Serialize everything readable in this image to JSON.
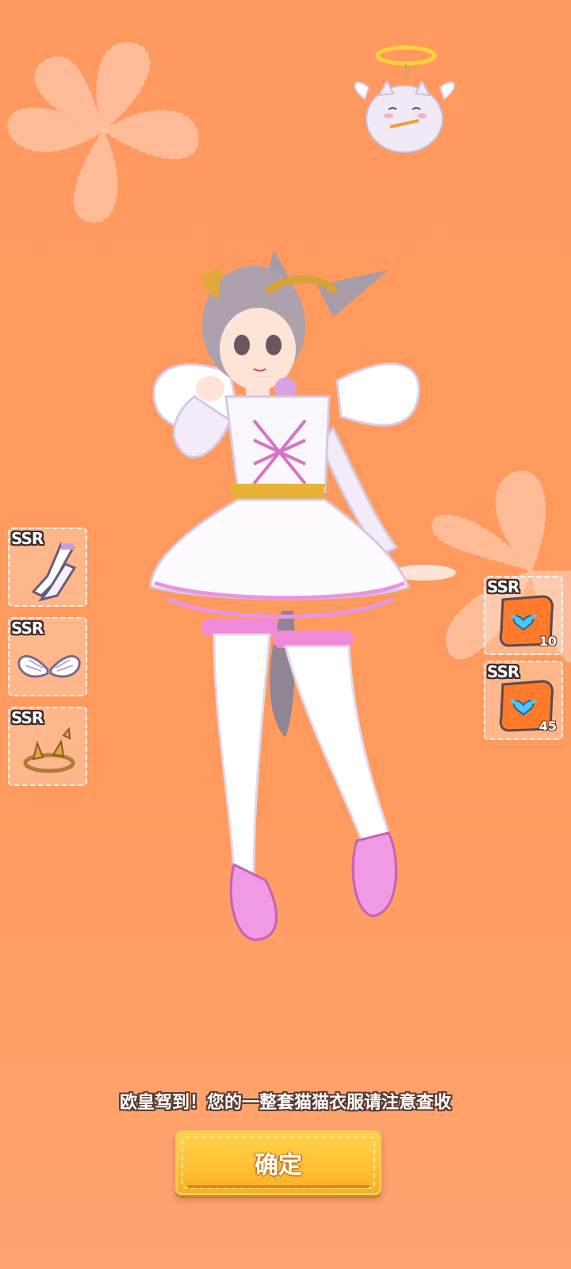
{
  "background": {
    "accent": "#ff9a5e",
    "flower_color": "#ffd4bf"
  },
  "left_items": [
    {
      "rarity": "SSR",
      "icon": "stockings-icon"
    },
    {
      "rarity": "SSR",
      "icon": "angel-wings-icon"
    },
    {
      "rarity": "SSR",
      "icon": "laurel-crown-icon"
    }
  ],
  "right_items": [
    {
      "rarity": "SSR",
      "icon": "angel-heart-shirt-icon",
      "count": "10"
    },
    {
      "rarity": "SSR",
      "icon": "angel-heart-shirt-icon",
      "count": "45"
    }
  ],
  "pet": {
    "icon": "angel-cat-pet-icon"
  },
  "character": {
    "icon": "angel-catgirl-character"
  },
  "message": "欧皇驾到！您的一整套猫猫衣服请注意查收",
  "confirm_button": {
    "label": "确定",
    "color": "#ffc236"
  }
}
